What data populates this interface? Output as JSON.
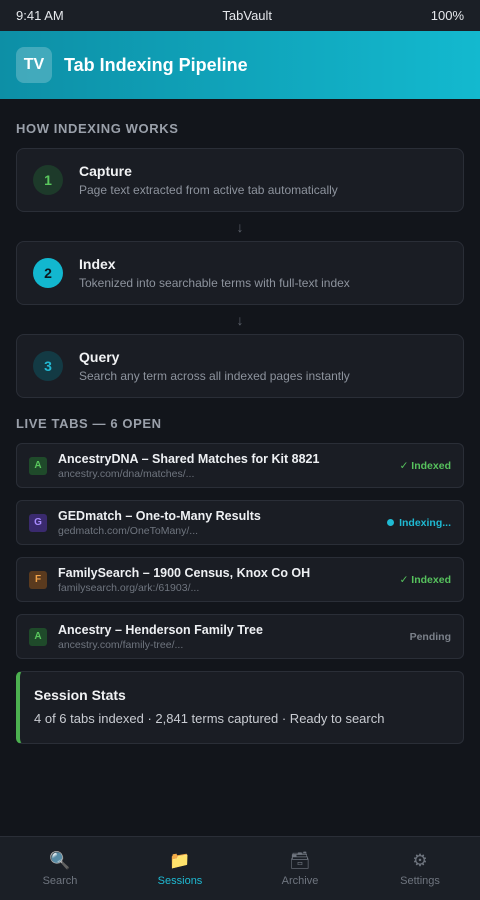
{
  "status_bar": {
    "time": "9:41 AM",
    "app": "TabVault",
    "battery": "100%"
  },
  "header": {
    "logo": "TV",
    "title": "Tab Indexing Pipeline"
  },
  "how_section": {
    "label": "HOW INDEXING WORKS",
    "arrow": "↓",
    "steps": [
      {
        "num": "1",
        "title": "Capture",
        "desc": "Page text extracted from active tab automatically"
      },
      {
        "num": "2",
        "title": "Index",
        "desc": "Tokenized into searchable terms with full-text index"
      },
      {
        "num": "3",
        "title": "Query",
        "desc": "Search any term across all indexed pages instantly"
      }
    ]
  },
  "live_tabs": {
    "label": "LIVE TABS — 6 OPEN",
    "tabs": [
      {
        "favicon": "A",
        "title": "AncestryDNA – Shared Matches for Kit 8821",
        "url": "ancestry.com/dna/matches/...",
        "status": "✓ Indexed"
      },
      {
        "favicon": "G",
        "title": "GEDmatch – One-to-Many Results",
        "url": "gedmatch.com/OneToMany/...",
        "status": "Indexing..."
      },
      {
        "favicon": "F",
        "title": "FamilySearch – 1900 Census, Knox Co OH",
        "url": "familysearch.org/ark:/61903/...",
        "status": "✓ Indexed"
      },
      {
        "favicon": "A",
        "title": "Ancestry – Henderson Family Tree",
        "url": "ancestry.com/family-tree/...",
        "status": "Pending"
      }
    ]
  },
  "stats": {
    "title": "Session Stats",
    "body": "4 of 6 tabs indexed · 2,841 terms captured · Ready to search"
  },
  "nav": {
    "items": [
      {
        "label": "Search",
        "icon": "🔍"
      },
      {
        "label": "Sessions",
        "icon": "📁"
      },
      {
        "label": "Archive",
        "icon": "🗃"
      },
      {
        "label": "Settings",
        "icon": "⚙"
      }
    ]
  },
  "colors": {
    "accent": "#13b9cf",
    "success": "#56c15d",
    "background": "#12151b"
  }
}
